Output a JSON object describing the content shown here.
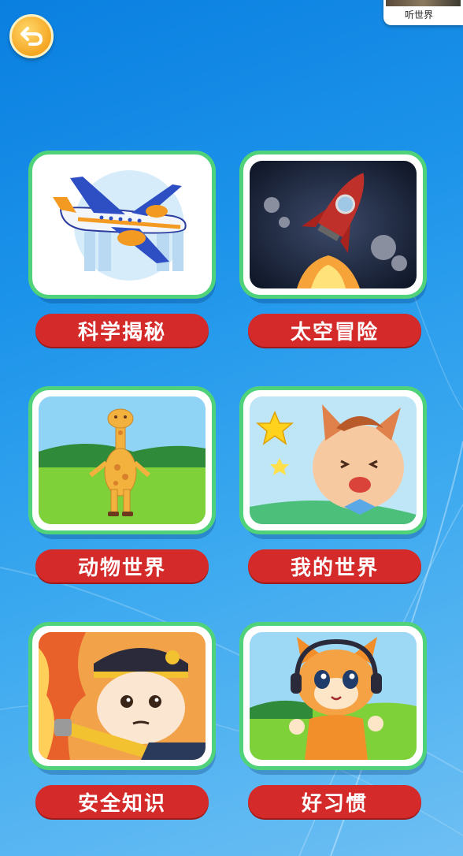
{
  "thumbnail": {
    "label": "听世界"
  },
  "categories": [
    {
      "label": "科学揭秘",
      "art": "airplane-illustration"
    },
    {
      "label": "太空冒险",
      "art": "rocket-illustration"
    },
    {
      "label": "动物世界",
      "art": "giraffe-illustration"
    },
    {
      "label": "我的世界",
      "art": "cat-star-illustration"
    },
    {
      "label": "安全知识",
      "art": "firefighter-illustration"
    },
    {
      "label": "好习惯",
      "art": "cat-headphones-illustration"
    }
  ],
  "colors": {
    "tile_border": "#4fd27a",
    "label_bg": "#d42a2a",
    "back_button": "#f5a623"
  },
  "icons": {
    "back": "return-arrow-icon"
  }
}
